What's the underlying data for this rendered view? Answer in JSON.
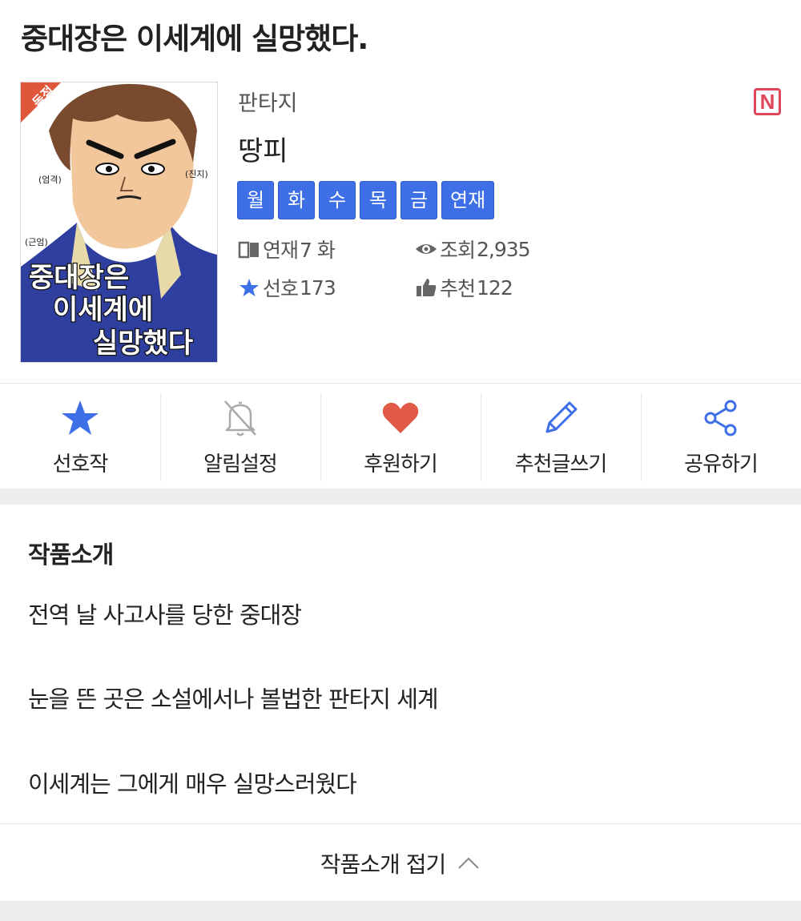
{
  "title": "중대장은 이세계에 실망했다.",
  "cover": {
    "badge": "독점",
    "title_lines": [
      "중대장은",
      "이세계에",
      "실망했다"
    ],
    "speech_marks": [
      "(엄격)",
      "(진지)",
      "(근엄)"
    ]
  },
  "genre": "판타지",
  "author": "땅피",
  "platform_badge": "N",
  "days": [
    "월",
    "화",
    "수",
    "목",
    "금"
  ],
  "status_tag": "연재",
  "stats": {
    "episodes": {
      "label": "연재",
      "value": "7 화"
    },
    "views": {
      "label": "조회",
      "value": "2,935"
    },
    "favorites": {
      "label": "선호",
      "value": "173"
    },
    "recommends": {
      "label": "추천",
      "value": "122"
    }
  },
  "actions": {
    "favorite": "선호작",
    "notify": "알림설정",
    "support": "후원하기",
    "review": "추천글쓰기",
    "share": "공유하기"
  },
  "intro": {
    "heading": "작품소개",
    "lines": [
      "전역 날 사고사를 당한 중대장",
      "눈을 뜬 곳은 소설에서나 볼법한 판타지 세계",
      "이세계는 그에게 매우 실망스러웠다"
    ],
    "collapse_label": "작품소개 접기"
  },
  "colors": {
    "accent_blue": "#3e6fe6",
    "heart_red": "#e05a47",
    "naver_pink": "#e0475a",
    "divider_gray": "#ececec"
  },
  "icons": {
    "favorite": "star-icon",
    "notify": "bell-off-icon",
    "support": "heart-icon",
    "review": "pencil-icon",
    "share": "share-icon",
    "collapse": "chevron-up-icon"
  }
}
